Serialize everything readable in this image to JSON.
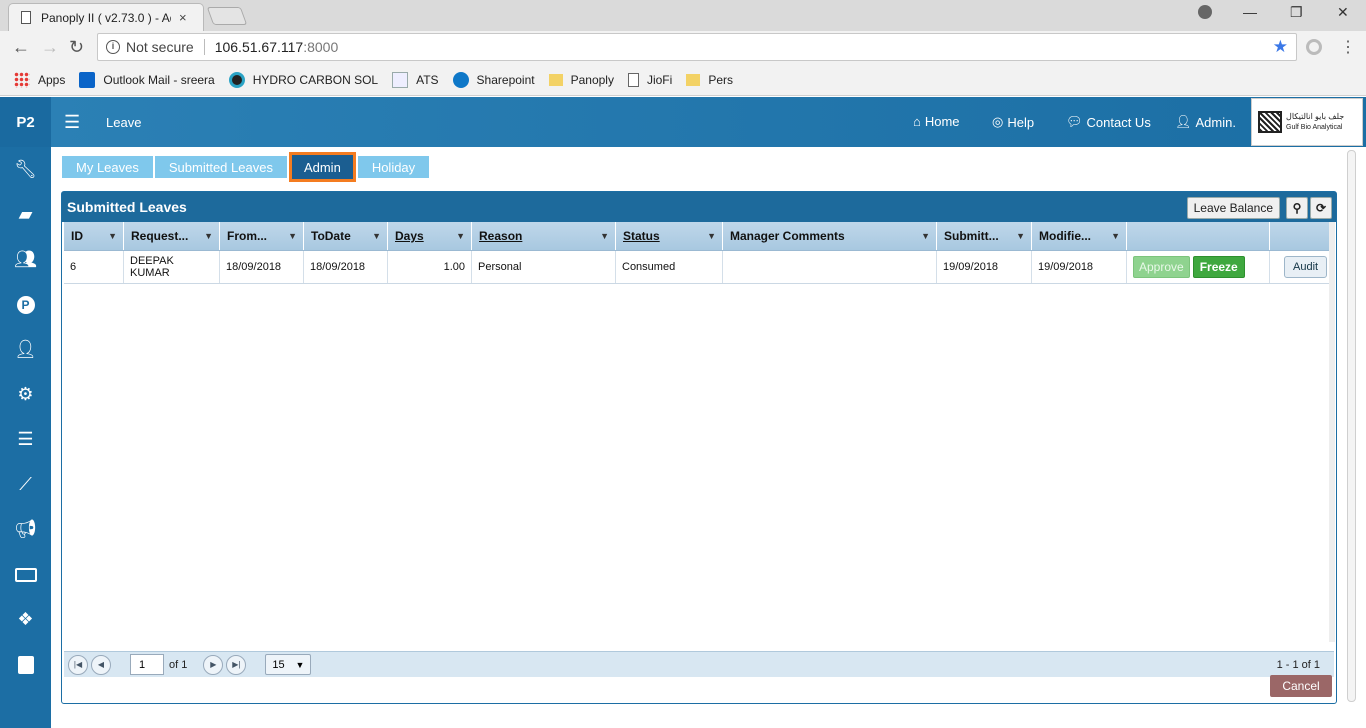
{
  "browser": {
    "tab_title": "Panoply II ( v2.73.0 ) - Ad",
    "tab_close": "×",
    "not_secure": "Not secure",
    "url_host": "106.51.67.117",
    "url_port": ":8000",
    "window_controls": [
      "—",
      "❐",
      "✕"
    ],
    "bookmarks": [
      {
        "label": "Apps",
        "icon": "apps-grid-icon",
        "color": "#e53935"
      },
      {
        "label": "Outlook Mail - sreera",
        "icon": "outlook-icon",
        "color": "#0a64c8"
      },
      {
        "label": "HYDRO CARBON SOL",
        "icon": "globe-icon",
        "color": "#2aa3c5"
      },
      {
        "label": "ATS",
        "icon": "document-icon",
        "color": "#9aa"
      },
      {
        "label": "Sharepoint",
        "icon": "sharepoint-icon",
        "color": "#0f78c8"
      },
      {
        "label": "Panoply",
        "icon": "folder-icon",
        "color": "#f3d265"
      },
      {
        "label": "JioFi",
        "icon": "page-icon",
        "color": "#fff"
      },
      {
        "label": "Pers",
        "icon": "folder-icon",
        "color": "#f3d265"
      }
    ]
  },
  "app": {
    "brand": "P2",
    "module_title": "Leave",
    "nav": {
      "home": "Home",
      "help": "Help",
      "contact": "Contact Us",
      "user": "Admin."
    },
    "logo": {
      "arabic": "جلف بايو انالتيكال",
      "english": "Gulf Bio Analytical"
    },
    "sidebar_icons": [
      "wrench-icon",
      "truck-icon",
      "users-icon",
      "parking-icon",
      "user-icon",
      "gear-icon",
      "database-icon",
      "chart-line-icon",
      "megaphone-icon",
      "money-icon",
      "cubes-icon",
      "contact-card-icon"
    ]
  },
  "tabs": [
    {
      "label": "My Leaves",
      "active": false
    },
    {
      "label": "Submitted Leaves",
      "active": false
    },
    {
      "label": "Admin",
      "active": true
    },
    {
      "label": "Holiday",
      "active": false
    }
  ],
  "panel": {
    "title": "Submitted Leaves",
    "leave_balance": "Leave Balance"
  },
  "grid": {
    "columns": [
      "ID",
      "Request...",
      "From...",
      "ToDate",
      "Days",
      "Reason",
      "Status",
      "Manager Comments",
      "Submitt...",
      "Modifie..."
    ],
    "rows": [
      {
        "id": "6",
        "requester": "DEEPAK KUMAR",
        "from": "18/09/2018",
        "to": "18/09/2018",
        "days": "1.00",
        "reason": "Personal",
        "status": "Consumed",
        "manager_comments": "",
        "submitted": "19/09/2018",
        "modified": "19/09/2018",
        "approve": "Approve",
        "freeze": "Freeze",
        "audit": "Audit"
      }
    ]
  },
  "pager": {
    "page": "1",
    "of": "of 1",
    "page_size": "15",
    "info": "1 - 1 of 1"
  },
  "cancel": "Cancel"
}
